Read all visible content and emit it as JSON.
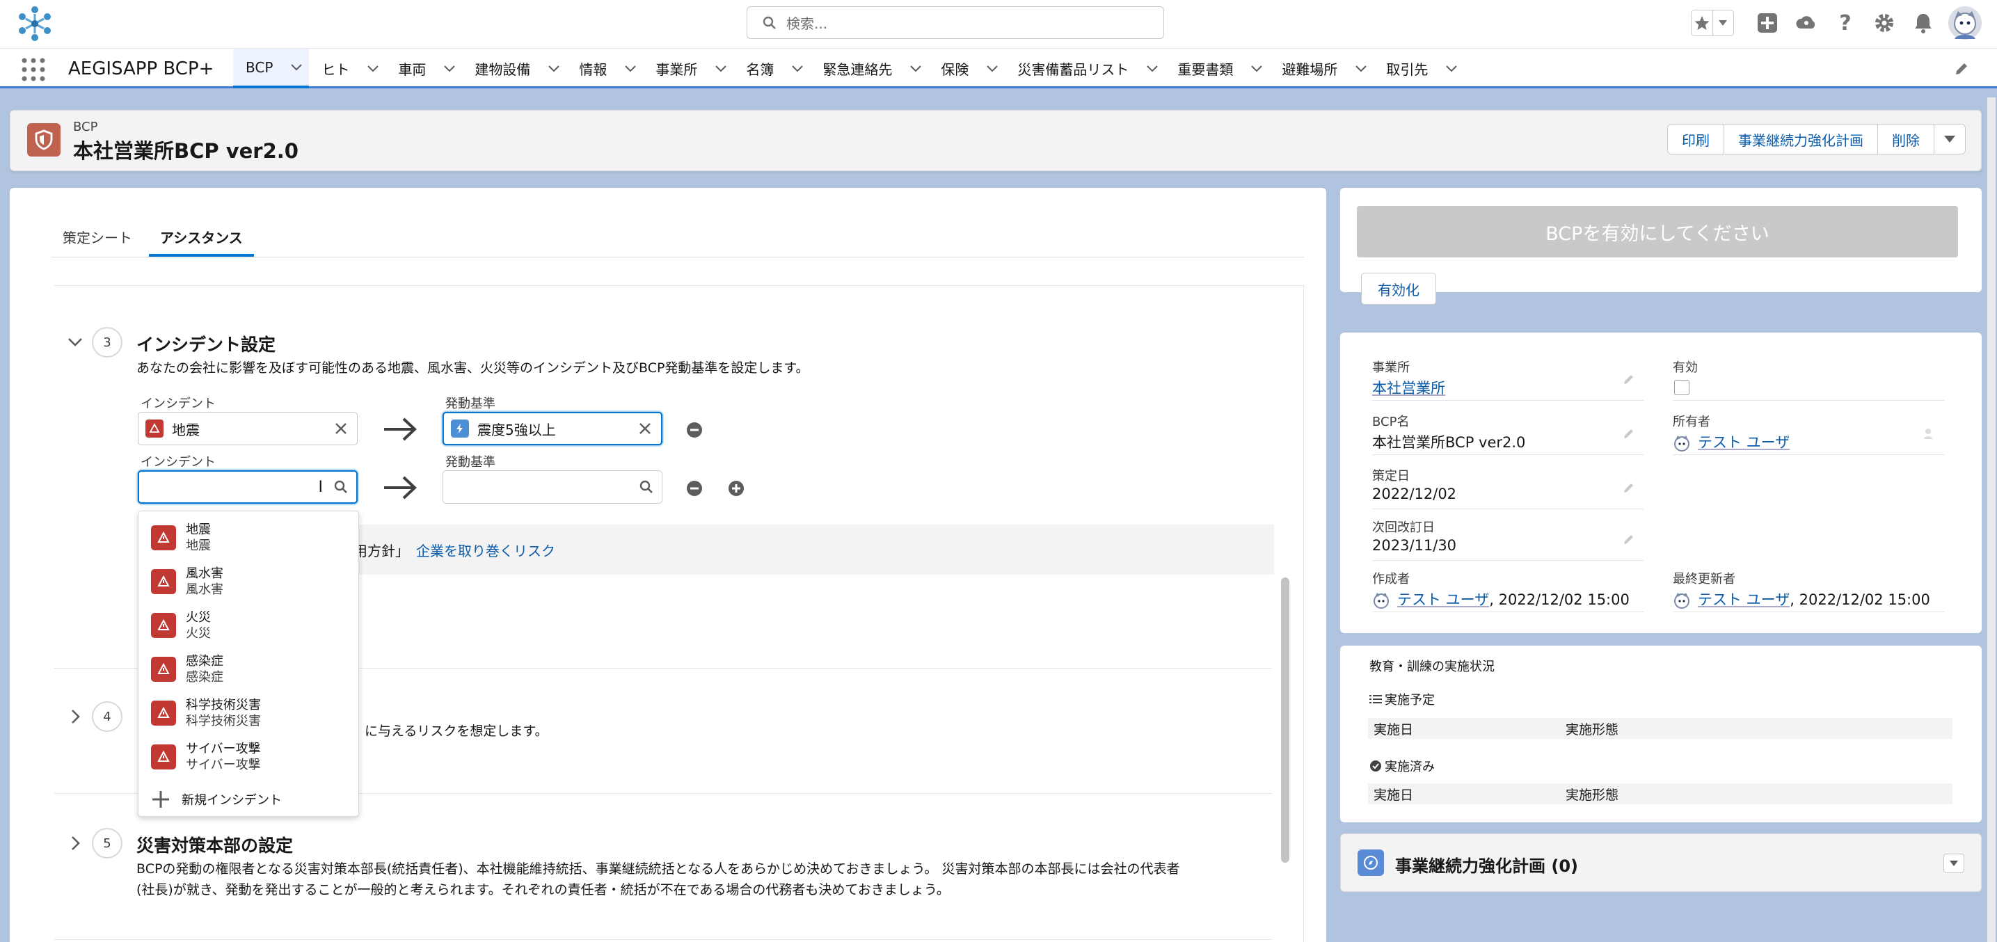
{
  "header": {
    "search_placeholder": "検索...",
    "colors": {
      "brand": "#0176d3",
      "incident": "#c23934",
      "trigger": "#4d8fd6"
    }
  },
  "nav": {
    "app_name": "AEGISAPP BCP+",
    "tabs": [
      "BCP",
      "ヒト",
      "車両",
      "建物設備",
      "情報",
      "事業所",
      "名簿",
      "緊急連絡先",
      "保険",
      "災害備蓄品リスト",
      "重要書類",
      "避難場所",
      "取引先"
    ]
  },
  "record": {
    "type": "BCP",
    "title": "本社営業所BCP ver2.0",
    "actions": [
      "印刷",
      "事業継続力強化計画",
      "削除"
    ]
  },
  "left": {
    "tabs": [
      "策定シート",
      "アシスタンス"
    ],
    "step3": {
      "number": "3",
      "title": "インシデント設定",
      "desc": "あなたの会社に影響を及ぼす可能性のある地震、風水害、火災等のインシデント及びBCP発動基準を設定します。",
      "row1": {
        "incident_label": "インシデント",
        "incident_value": "地震",
        "trigger_label": "発動基準",
        "trigger_value": "震度5強以上"
      },
      "row2": {
        "incident_label": "インシデント",
        "trigger_label": "発動基準"
      },
      "hint_partial": "運用方針」",
      "hint_link": "企業を取り巻くリスク"
    },
    "step4": {
      "number": "4",
      "desc_partial": "に与えるリスクを想定します。"
    },
    "step5": {
      "number": "5",
      "title": "災害対策本部の設定",
      "desc1": "BCPの発動の権限者となる災害対策本部長(統括責任者)、本社機能維持統括、事業継続統括となる人をあらかじめ決めておきましょう。 災害対策本部の本部長には会社の代表者",
      "desc2": "(社長)が就き、発動を発出することが一般的と考えられます。それぞれの責任者・統括が不在である場合の代務者も決めておきましょう。"
    },
    "dropdown": [
      {
        "name": "地震",
        "sub": "地震"
      },
      {
        "name": "風水害",
        "sub": "風水害"
      },
      {
        "name": "火災",
        "sub": "火災"
      },
      {
        "name": "感染症",
        "sub": "感染症"
      },
      {
        "name": "科学技術災害",
        "sub": "科学技術災害"
      },
      {
        "name": "サイバー攻撃",
        "sub": "サイバー攻撃"
      }
    ],
    "dropdown_new": "新規インシデント"
  },
  "right": {
    "banner": "BCPを有効にしてください",
    "activate": "有効化",
    "fields": {
      "office_label": "事業所",
      "office_value": "本社営業所",
      "active_label": "有効",
      "bcpname_label": "BCP名",
      "bcpname_value": "本社営業所BCP ver2.0",
      "owner_label": "所有者",
      "owner_value": "テスト ユーザ",
      "date_label": "策定日",
      "date_value": "2022/12/02",
      "next_label": "次回改訂日",
      "next_value": "2023/11/30",
      "creator_label": "作成者",
      "creator_value": "テスト ユーザ",
      "creator_time": ", 2022/12/02 15:00",
      "updater_label": "最終更新者",
      "updater_value": "テスト ユーザ",
      "updater_time": ", 2022/12/02 15:00"
    },
    "training": {
      "title": "教育・訓練の実施状況",
      "planned": "実施予定",
      "done": "実施済み",
      "col_date": "実施日",
      "col_type": "実施形態"
    },
    "plan": {
      "title": "事業継続力強化計画 (0)"
    }
  }
}
